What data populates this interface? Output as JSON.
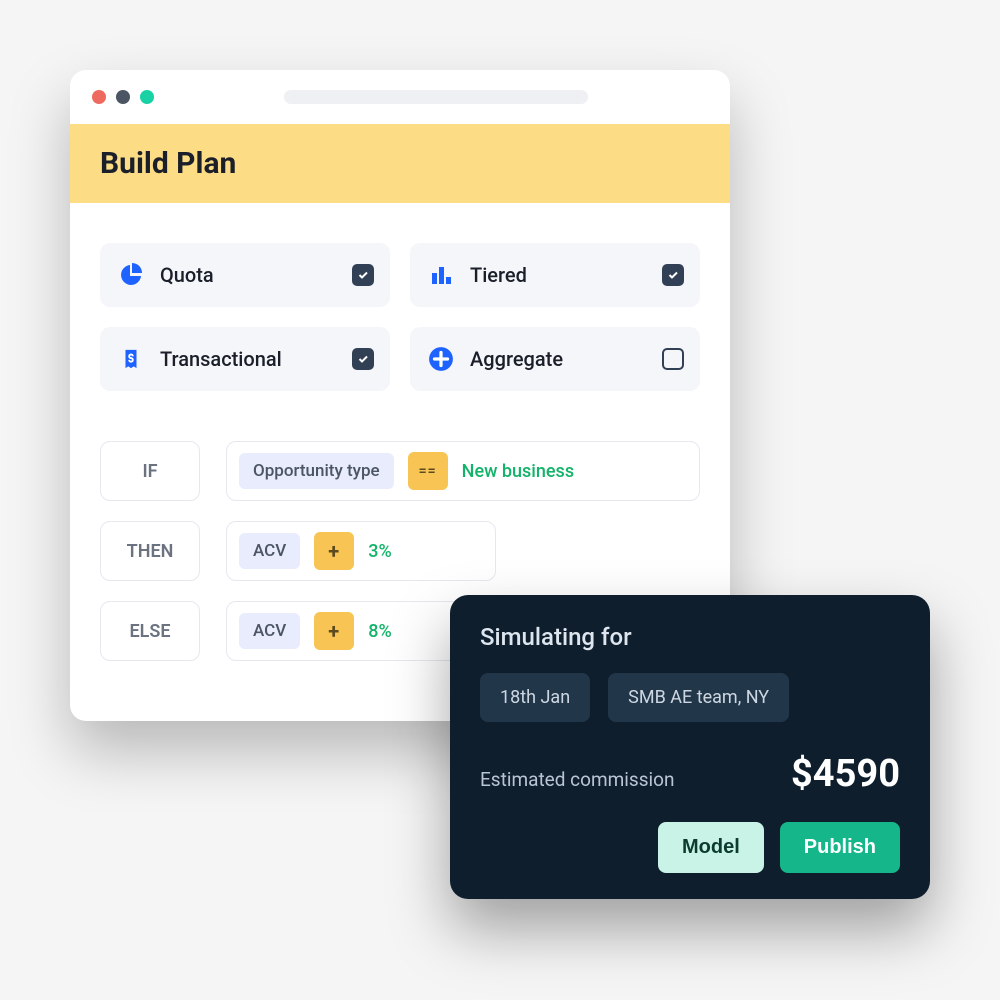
{
  "header": {
    "title": "Build Plan"
  },
  "options": {
    "quota": {
      "label": "Quota",
      "checked": true
    },
    "tiered": {
      "label": "Tiered",
      "checked": true
    },
    "transactional": {
      "label": "Transactional",
      "checked": true
    },
    "aggregate": {
      "label": "Aggregate",
      "checked": false
    }
  },
  "rules": {
    "if": {
      "keyword": "IF",
      "field": "Opportunity type",
      "op": "==",
      "value": "New business"
    },
    "then": {
      "keyword": "THEN",
      "field": "ACV",
      "op": "+",
      "value": "3%"
    },
    "else": {
      "keyword": "ELSE",
      "field": "ACV",
      "op": "+",
      "value": "8%"
    }
  },
  "simulation": {
    "title": "Simulating for",
    "date_chip": "18th Jan",
    "team_chip": "SMB AE team, NY",
    "est_label": "Estimated commission",
    "amount": "$4590",
    "model_label": "Model",
    "publish_label": "Publish"
  }
}
